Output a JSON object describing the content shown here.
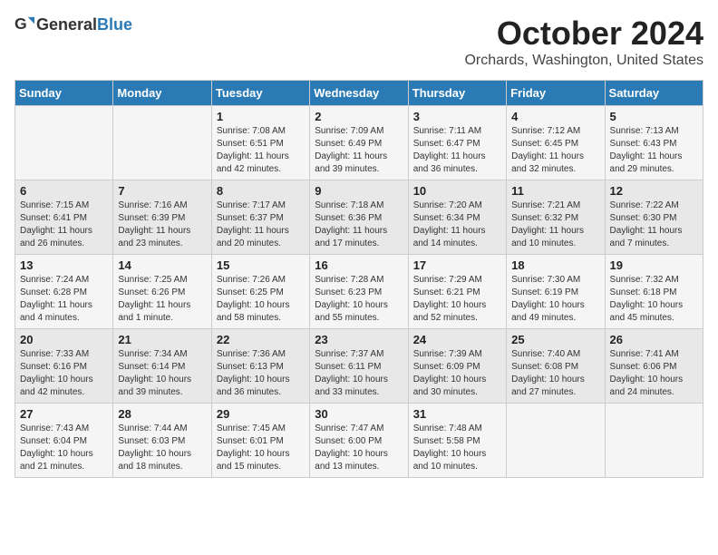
{
  "header": {
    "logo_general": "General",
    "logo_blue": "Blue",
    "title": "October 2024",
    "location": "Orchards, Washington, United States"
  },
  "days_of_week": [
    "Sunday",
    "Monday",
    "Tuesday",
    "Wednesday",
    "Thursday",
    "Friday",
    "Saturday"
  ],
  "weeks": [
    [
      {
        "day": "",
        "content": ""
      },
      {
        "day": "",
        "content": ""
      },
      {
        "day": "1",
        "content": "Sunrise: 7:08 AM\nSunset: 6:51 PM\nDaylight: 11 hours and 42 minutes."
      },
      {
        "day": "2",
        "content": "Sunrise: 7:09 AM\nSunset: 6:49 PM\nDaylight: 11 hours and 39 minutes."
      },
      {
        "day": "3",
        "content": "Sunrise: 7:11 AM\nSunset: 6:47 PM\nDaylight: 11 hours and 36 minutes."
      },
      {
        "day": "4",
        "content": "Sunrise: 7:12 AM\nSunset: 6:45 PM\nDaylight: 11 hours and 32 minutes."
      },
      {
        "day": "5",
        "content": "Sunrise: 7:13 AM\nSunset: 6:43 PM\nDaylight: 11 hours and 29 minutes."
      }
    ],
    [
      {
        "day": "6",
        "content": "Sunrise: 7:15 AM\nSunset: 6:41 PM\nDaylight: 11 hours and 26 minutes."
      },
      {
        "day": "7",
        "content": "Sunrise: 7:16 AM\nSunset: 6:39 PM\nDaylight: 11 hours and 23 minutes."
      },
      {
        "day": "8",
        "content": "Sunrise: 7:17 AM\nSunset: 6:37 PM\nDaylight: 11 hours and 20 minutes."
      },
      {
        "day": "9",
        "content": "Sunrise: 7:18 AM\nSunset: 6:36 PM\nDaylight: 11 hours and 17 minutes."
      },
      {
        "day": "10",
        "content": "Sunrise: 7:20 AM\nSunset: 6:34 PM\nDaylight: 11 hours and 14 minutes."
      },
      {
        "day": "11",
        "content": "Sunrise: 7:21 AM\nSunset: 6:32 PM\nDaylight: 11 hours and 10 minutes."
      },
      {
        "day": "12",
        "content": "Sunrise: 7:22 AM\nSunset: 6:30 PM\nDaylight: 11 hours and 7 minutes."
      }
    ],
    [
      {
        "day": "13",
        "content": "Sunrise: 7:24 AM\nSunset: 6:28 PM\nDaylight: 11 hours and 4 minutes."
      },
      {
        "day": "14",
        "content": "Sunrise: 7:25 AM\nSunset: 6:26 PM\nDaylight: 11 hours and 1 minute."
      },
      {
        "day": "15",
        "content": "Sunrise: 7:26 AM\nSunset: 6:25 PM\nDaylight: 10 hours and 58 minutes."
      },
      {
        "day": "16",
        "content": "Sunrise: 7:28 AM\nSunset: 6:23 PM\nDaylight: 10 hours and 55 minutes."
      },
      {
        "day": "17",
        "content": "Sunrise: 7:29 AM\nSunset: 6:21 PM\nDaylight: 10 hours and 52 minutes."
      },
      {
        "day": "18",
        "content": "Sunrise: 7:30 AM\nSunset: 6:19 PM\nDaylight: 10 hours and 49 minutes."
      },
      {
        "day": "19",
        "content": "Sunrise: 7:32 AM\nSunset: 6:18 PM\nDaylight: 10 hours and 45 minutes."
      }
    ],
    [
      {
        "day": "20",
        "content": "Sunrise: 7:33 AM\nSunset: 6:16 PM\nDaylight: 10 hours and 42 minutes."
      },
      {
        "day": "21",
        "content": "Sunrise: 7:34 AM\nSunset: 6:14 PM\nDaylight: 10 hours and 39 minutes."
      },
      {
        "day": "22",
        "content": "Sunrise: 7:36 AM\nSunset: 6:13 PM\nDaylight: 10 hours and 36 minutes."
      },
      {
        "day": "23",
        "content": "Sunrise: 7:37 AM\nSunset: 6:11 PM\nDaylight: 10 hours and 33 minutes."
      },
      {
        "day": "24",
        "content": "Sunrise: 7:39 AM\nSunset: 6:09 PM\nDaylight: 10 hours and 30 minutes."
      },
      {
        "day": "25",
        "content": "Sunrise: 7:40 AM\nSunset: 6:08 PM\nDaylight: 10 hours and 27 minutes."
      },
      {
        "day": "26",
        "content": "Sunrise: 7:41 AM\nSunset: 6:06 PM\nDaylight: 10 hours and 24 minutes."
      }
    ],
    [
      {
        "day": "27",
        "content": "Sunrise: 7:43 AM\nSunset: 6:04 PM\nDaylight: 10 hours and 21 minutes."
      },
      {
        "day": "28",
        "content": "Sunrise: 7:44 AM\nSunset: 6:03 PM\nDaylight: 10 hours and 18 minutes."
      },
      {
        "day": "29",
        "content": "Sunrise: 7:45 AM\nSunset: 6:01 PM\nDaylight: 10 hours and 15 minutes."
      },
      {
        "day": "30",
        "content": "Sunrise: 7:47 AM\nSunset: 6:00 PM\nDaylight: 10 hours and 13 minutes."
      },
      {
        "day": "31",
        "content": "Sunrise: 7:48 AM\nSunset: 5:58 PM\nDaylight: 10 hours and 10 minutes."
      },
      {
        "day": "",
        "content": ""
      },
      {
        "day": "",
        "content": ""
      }
    ]
  ]
}
